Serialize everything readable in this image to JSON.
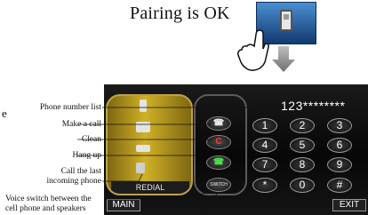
{
  "header": {
    "pairing_text": "Pairing  is OK"
  },
  "icons": {
    "phone": "mobile-phone-icon",
    "hand": "pointing-hand-icon",
    "arrow": "down-arrow-icon"
  },
  "fragment": "e",
  "display": {
    "number": "123********"
  },
  "keypad": {
    "keys": [
      "1",
      "2",
      "3",
      "4",
      "5",
      "6",
      "7",
      "8",
      "9",
      "*",
      "0",
      "#"
    ]
  },
  "side_buttons": {
    "clean": "C",
    "switch": "SWITCH"
  },
  "sidebar": {
    "redial": "REDIAL"
  },
  "bottom": {
    "main": "MAIN",
    "exit": "EXIT"
  },
  "callouts": {
    "phone_list": "Phone number list",
    "make_call": "Make a call",
    "clean": "Clean",
    "hang_up": "Hang up",
    "call_last_1": "Call the last",
    "call_last_2": "incoming phone",
    "voice_1": "Voice switch between the",
    "voice_2": "cell phone and speakers"
  },
  "colors": {
    "accent_gold": "#c9aa25",
    "clean_red": "#ff3b3b",
    "call_green": "#4be04b"
  }
}
